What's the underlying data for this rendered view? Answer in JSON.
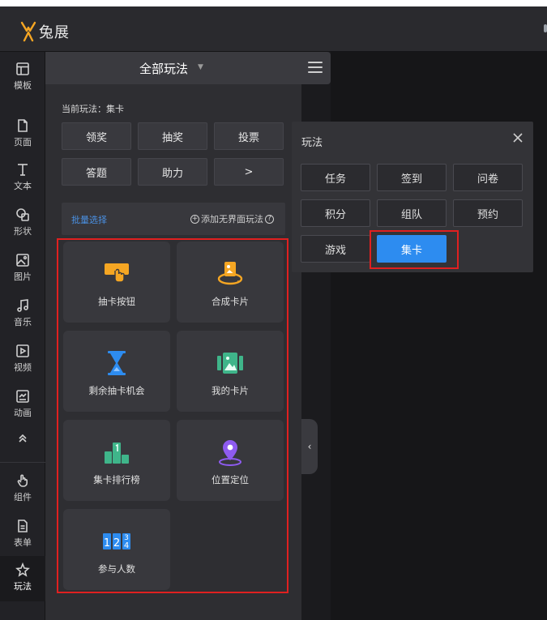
{
  "app": {
    "logo_text": "兔展"
  },
  "sidebar": {
    "items": [
      {
        "label": "模板",
        "icon": "template-icon"
      },
      {
        "label": "页面",
        "icon": "page-icon"
      },
      {
        "label": "文本",
        "icon": "text-icon"
      },
      {
        "label": "形状",
        "icon": "shape-icon"
      },
      {
        "label": "图片",
        "icon": "image-icon"
      },
      {
        "label": "音乐",
        "icon": "music-icon"
      },
      {
        "label": "视频",
        "icon": "video-icon"
      },
      {
        "label": "动画",
        "icon": "animation-icon"
      },
      {
        "label": "组件",
        "icon": "component-icon"
      },
      {
        "label": "表单",
        "icon": "form-icon"
      },
      {
        "label": "玩法",
        "icon": "gameplay-icon",
        "active": true
      }
    ]
  },
  "panel": {
    "title": "全部玩法",
    "current": "当前玩法：集卡",
    "buttons": [
      "领奖",
      "抽奖",
      "投票",
      "答题",
      "助力",
      ">"
    ],
    "batch_select": "批量选择",
    "add_link": "添加无界面玩法",
    "cards": [
      {
        "label": "抽卡按钮",
        "icon": "draw-card-button-icon"
      },
      {
        "label": "合成卡片",
        "icon": "compose-card-icon"
      },
      {
        "label": "剩余抽卡机会",
        "icon": "hourglass-icon"
      },
      {
        "label": "我的卡片",
        "icon": "my-cards-icon"
      },
      {
        "label": "集卡排行榜",
        "icon": "leaderboard-icon"
      },
      {
        "label": "位置定位",
        "icon": "location-pin-icon"
      },
      {
        "label": "参与人数",
        "icon": "counter-icon",
        "digits": [
          "1",
          "2",
          "3",
          "4"
        ]
      }
    ]
  },
  "popup": {
    "title": "玩法",
    "options": [
      "任务",
      "签到",
      "问卷",
      "积分",
      "组队",
      "预约",
      "游戏",
      "集卡"
    ],
    "selected": "集卡"
  },
  "colors": {
    "accent": "#2d8cf0",
    "highlight": "#e02020",
    "logo": "#f5a623"
  }
}
